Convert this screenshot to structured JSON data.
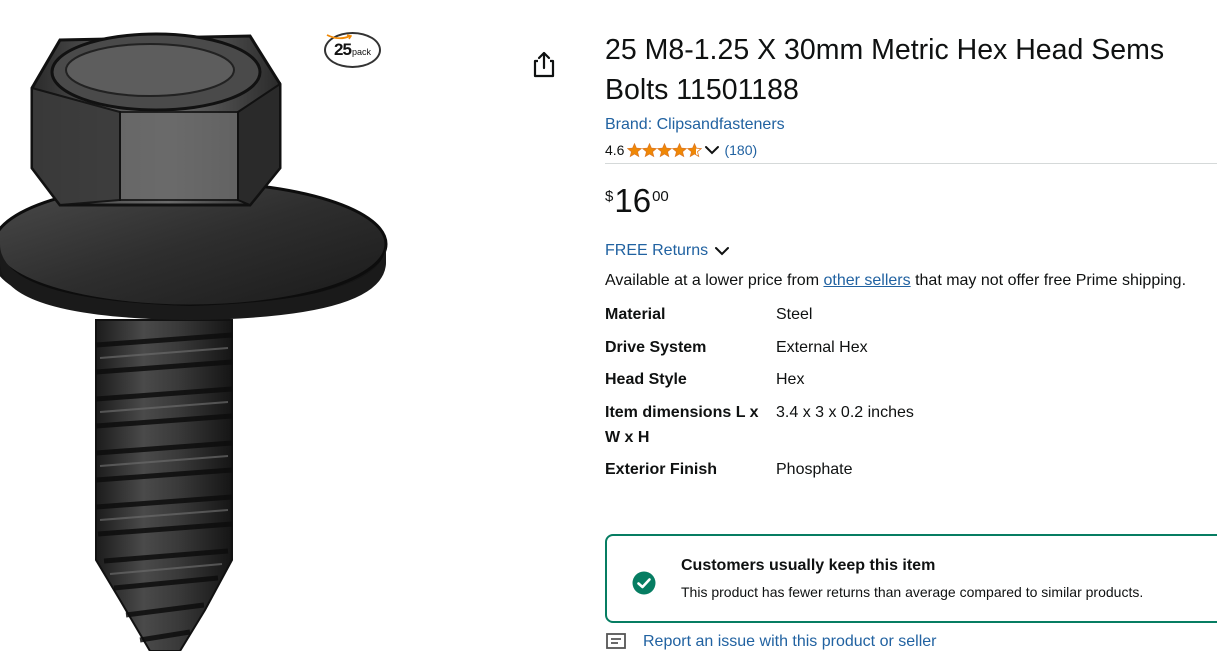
{
  "image": {
    "pack_badge_number": "25",
    "pack_badge_word": "pack",
    "alt": "M8-1.25 X 30mm Metric Hex Head Sems Bolt"
  },
  "share": {
    "icon": "share-icon"
  },
  "product": {
    "title": "25 M8-1.25 X 30mm Metric Hex Head Sems Bolts 11501188",
    "brand": "Brand: Clipsandfasteners",
    "rating": "4.6",
    "rating_value": 4.6,
    "rating_count": "(180)",
    "star_color": "#F08804"
  },
  "price": {
    "symbol": "$",
    "whole": "16",
    "fraction": "00"
  },
  "returns": {
    "label": "FREE Returns"
  },
  "availability": {
    "before_link": "Available at a lower price from ",
    "link": "other sellers",
    "after_link": " that may not offer free Prime shipping."
  },
  "specs": [
    {
      "key": "Material",
      "value": "Steel"
    },
    {
      "key": "Drive System",
      "value": "External Hex"
    },
    {
      "key": "Head Style",
      "value": "Hex"
    },
    {
      "key": "Item dimensions L x W x H",
      "value": "3.4 x 3 x 0.2 inches"
    },
    {
      "key": "Exterior Finish",
      "value": "Phosphate"
    }
  ],
  "keep_box": {
    "title": "Customers usually keep this item",
    "description": "This product has fewer returns than average compared to similar products.",
    "accent_color": "#067D62"
  },
  "report": {
    "label": "Report an issue with this product or seller"
  },
  "colors": {
    "link": "#2162A1",
    "text": "#0F1111",
    "divider": "#D5D9D9"
  }
}
